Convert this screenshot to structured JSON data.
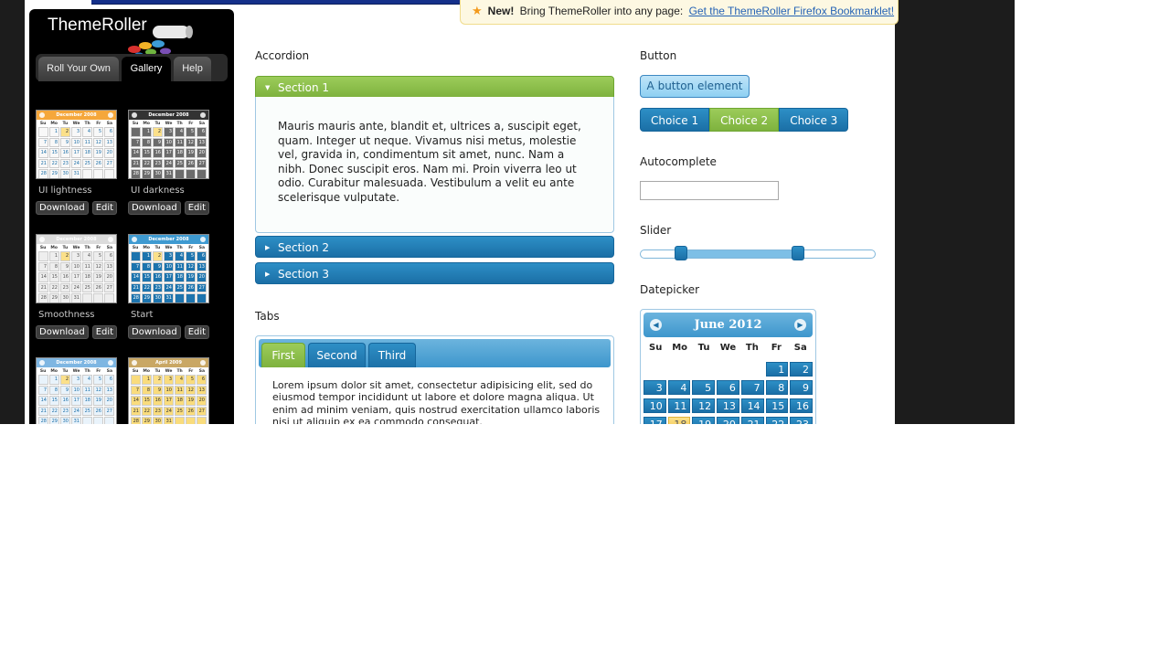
{
  "notice": {
    "new_label": "New!",
    "text": "Bring ThemeRoller into any page:",
    "link": "Get the ThemeRoller Firefox Bookmarklet!"
  },
  "sidebar": {
    "logo": "ThemeRoller",
    "nav": [
      "Roll Your Own",
      "Gallery",
      "Help"
    ],
    "download_label": "Download",
    "edit_label": "Edit",
    "themes": [
      {
        "name": "UI lightness",
        "month": "December 2008",
        "header_color": "#f5a73b",
        "cell_color": "#f8f8f8",
        "text_color": "#1c6fa8"
      },
      {
        "name": "UI darkness",
        "month": "December 2008",
        "header_color": "#333333",
        "cell_color": "#6b6b6b",
        "text_color": "#ffffff"
      },
      {
        "name": "Smoothness",
        "month": "December 2008",
        "header_color": "#dcdcdc",
        "cell_color": "#eeeeee",
        "text_color": "#555555"
      },
      {
        "name": "Start",
        "month": "December 2008",
        "header_color": "#3e9ad1",
        "cell_color": "#1d74ae",
        "text_color": "#ffffff"
      },
      {
        "name": "",
        "month": "December 2008",
        "header_color": "#7eb6e2",
        "cell_color": "#e9f3fb",
        "text_color": "#1c6fa8"
      },
      {
        "name": "",
        "month": "April 2009",
        "header_color": "#c9a764",
        "cell_color": "#f9dc7d",
        "text_color": "#333333"
      }
    ]
  },
  "accordion": {
    "label": "Accordion",
    "sections": [
      "Section 1",
      "Section 2",
      "Section 3"
    ],
    "body": "Mauris mauris ante, blandit et, ultrices a, suscipit eget, quam. Integer ut neque. Vivamus nisi metus, molestie vel, gravida in, condimentum sit amet, nunc. Nam a nibh. Donec suscipit eros. Nam mi. Proin viverra leo ut odio. Curabitur malesuada. Vestibulum a velit eu ante scelerisque vulputate."
  },
  "tabs": {
    "label": "Tabs",
    "items": [
      "First",
      "Second",
      "Third"
    ],
    "body": "Lorem ipsum dolor sit amet, consectetur adipisicing elit, sed do eiusmod tempor incididunt ut labore et dolore magna aliqua. Ut enim ad minim veniam, quis nostrud exercitation ullamco laboris nisi ut aliquip ex ea commodo consequat."
  },
  "button": {
    "label": "Button",
    "element": "A button element",
    "choices": [
      "Choice 1",
      "Choice 2",
      "Choice 3"
    ],
    "selected": "Choice 2"
  },
  "autocomplete": {
    "label": "Autocomplete",
    "value": ""
  },
  "slider": {
    "label": "Slider",
    "range_min_pct": 17,
    "range_max_pct": 67
  },
  "datepicker": {
    "label": "Datepicker",
    "month": "June 2012",
    "dows": [
      "Su",
      "Mo",
      "Tu",
      "We",
      "Th",
      "Fr",
      "Sa"
    ],
    "first_weekday": 5,
    "days_in_month": 30,
    "today": 18,
    "prev_icon": "circle-arrow-left-icon",
    "next_icon": "circle-arrow-right-icon"
  },
  "colors": {
    "accent_blue": "#1b6fa6",
    "accent_green": "#7eb23e",
    "highlight_yellow": "#f6c94f"
  }
}
